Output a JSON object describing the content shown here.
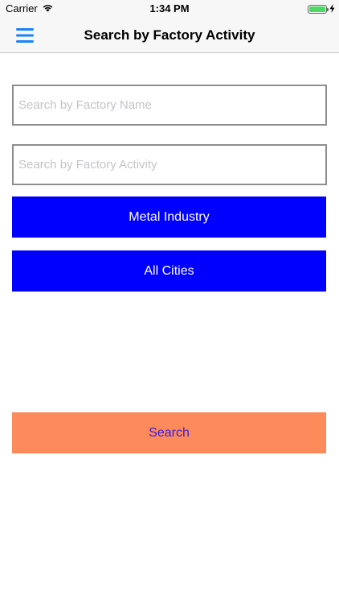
{
  "status_bar": {
    "carrier": "Carrier",
    "time": "1:34 PM",
    "icons": [
      "wifi-icon",
      "battery-icon",
      "charging-bolt-icon"
    ],
    "battery_level": 1.0
  },
  "nav_bar": {
    "menu_icon": "hamburger-menu-icon",
    "title": "Search by Factory Activity",
    "accent_color": "#1a82fb"
  },
  "form": {
    "factory_name": {
      "value": "",
      "placeholder": "Search by Factory Name"
    },
    "factory_activity": {
      "value": "",
      "placeholder": "Search by Factory Activity"
    },
    "industry_button": "Metal Industry",
    "cities_button": "All Cities",
    "search_button": "Search"
  },
  "colors": {
    "selector_button_bg": "#0000ff",
    "search_button_bg": "#fd8a5b",
    "search_button_text": "#3a1cdc"
  }
}
